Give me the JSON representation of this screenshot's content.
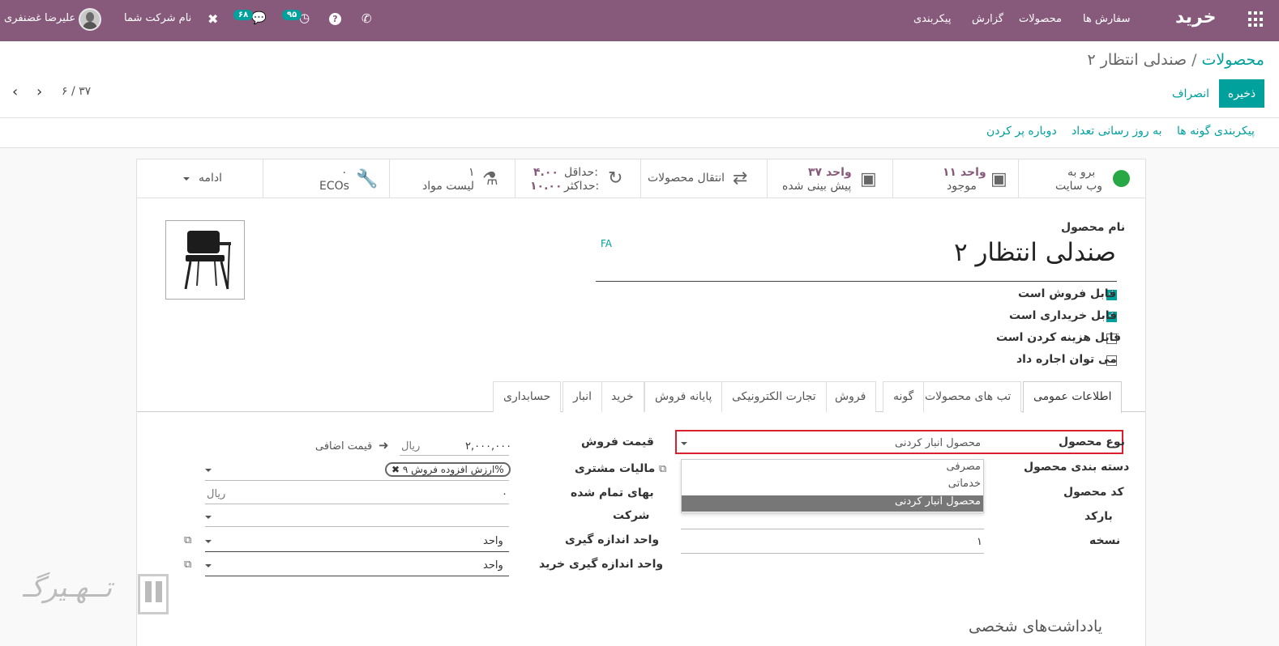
{
  "navbar": {
    "app_name": "خرید",
    "menu": [
      "سفارش ها",
      "محصولات",
      "گزارش",
      "پیکربندی"
    ],
    "company": "نام شرکت شما",
    "user": "علیرضا غضنفری",
    "activity_count": "۹۵",
    "message_count": "۶۸"
  },
  "breadcrumb": {
    "parent": "محصولات",
    "separator": "/",
    "current": "صندلی انتظار ۲"
  },
  "buttons": {
    "save": "ذخیره",
    "discard": "انصراف"
  },
  "pager": {
    "text": "۶ / ۳۷"
  },
  "header_buttons": [
    "پیکربندی گونه ها",
    "به روز رسانی تعداد",
    "دوباره پر کردن"
  ],
  "smart_buttons": {
    "website": {
      "line1": "برو به",
      "line2": "وب سایت"
    },
    "on_hand": {
      "value": "۱۱ واحد",
      "label": "موجود"
    },
    "forecast": {
      "value": "۳۷ واحد",
      "label": "پیش بینی شده"
    },
    "moves": {
      "label": "انتقال محصولات"
    },
    "minmax": {
      "min_label": "حداقل:",
      "min_value": "۴.۰۰",
      "max_label": "حداکثر:",
      "max_value": "۱۰.۰۰"
    },
    "bom": {
      "value": "۱",
      "label": "لیست مواد"
    },
    "ecos": {
      "value": "۰",
      "label": "ECOs"
    },
    "more": "ادامه"
  },
  "product": {
    "name_label": "نام محصول",
    "name": "صندلی انتظار ۲",
    "lang": "FA",
    "checkboxes": [
      {
        "label": "قابل فروش است",
        "checked": true
      },
      {
        "label": "قابل خریداری است",
        "checked": true
      },
      {
        "label": "قابل هزینه کردن است",
        "checked": false
      },
      {
        "label": "می توان اجاره داد",
        "checked": false
      }
    ]
  },
  "tabs": [
    "اطلاعات عمومی",
    "تب های محصولات",
    "گونه",
    "فروش",
    "تجارت الکترونیکی",
    "پایانه فروش",
    "خرید",
    "انبار",
    "حسابداری"
  ],
  "left_fields": {
    "type_label": "نوع محصول",
    "type_value": "محصول انبار کردنی",
    "category_label": "دسته بندی محصول",
    "ref_label": "کد محصول",
    "barcode_label": "بارکد",
    "version_label": "نسخه",
    "version_value": "۱"
  },
  "dropdown_options": [
    "مصرفی",
    "خدماتی",
    "محصول انبار کردنی"
  ],
  "right_fields": {
    "price_label": "قیمت فروش",
    "price_value": "۲,۰۰۰,۰۰۰",
    "price_currency": "ریال",
    "extra_price": "قیمت اضافی",
    "tax_label": "مالیات مشتری",
    "tax_tag": "ارزش افزوده فروش ۹%",
    "cost_label": "بهای تمام شده",
    "cost_value": "۰",
    "cost_currency": "ریال",
    "company_label": "شرکت",
    "uom_label": "واحد اندازه گیری",
    "uom_value": "واحد",
    "po_uom_label": "واحد اندازه گیری خرید",
    "po_uom_value": "واحد"
  },
  "notes_title": "یادداشت‌های شخصی",
  "watermark": "تــهـیرگـ"
}
